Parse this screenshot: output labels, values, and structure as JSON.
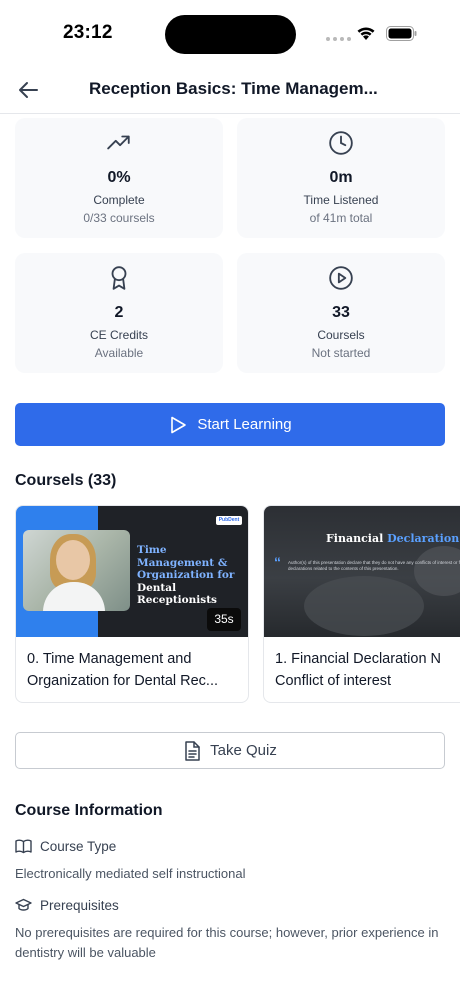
{
  "status_bar": {
    "time": "23:12"
  },
  "header": {
    "title": "Reception Basics: Time Managem..."
  },
  "stats": [
    {
      "icon": "trending-up-icon",
      "value": "0%",
      "label": "Complete",
      "sub": "0/33 coursels"
    },
    {
      "icon": "clock-icon",
      "value": "0m",
      "label": "Time Listened",
      "sub": "of 41m total"
    },
    {
      "icon": "award-icon",
      "value": "2",
      "label": "CE Credits",
      "sub": "Available"
    },
    {
      "icon": "play-circle-icon",
      "value": "33",
      "label": "Coursels",
      "sub": "Not started"
    }
  ],
  "start_button": {
    "label": "Start Learning"
  },
  "courses": {
    "heading": "Coursels (33)",
    "items": [
      {
        "thumb_title_a": "Time Management & Organization for",
        "thumb_title_b": "Dental Receptionists",
        "logo": "PubDent",
        "duration": "35s",
        "title_line1": "0. Time Management and",
        "title_line2": "Organization for Dental Rec..."
      },
      {
        "thumb_title_a": "Financial",
        "thumb_title_b": "Declaration",
        "thumb_text": "Author(s) of this presentation declare that they do not have any conflicts of interest or financial declarations related to the contents of this presentation.",
        "title_line1": "1. Financial Declaration N",
        "title_line2": "Conflict of interest"
      }
    ]
  },
  "quiz_button": {
    "label": "Take Quiz"
  },
  "course_info": {
    "heading": "Course Information",
    "type_label": "Course Type",
    "type_value": "Electronically mediated self instructional",
    "prereq_label": "Prerequisites",
    "prereq_value": "No prerequisites are required for this course; however, prior experience in dentistry will be valuable"
  },
  "colors": {
    "accent": "#2f6bea",
    "card_bg": "#f8f9fb"
  }
}
